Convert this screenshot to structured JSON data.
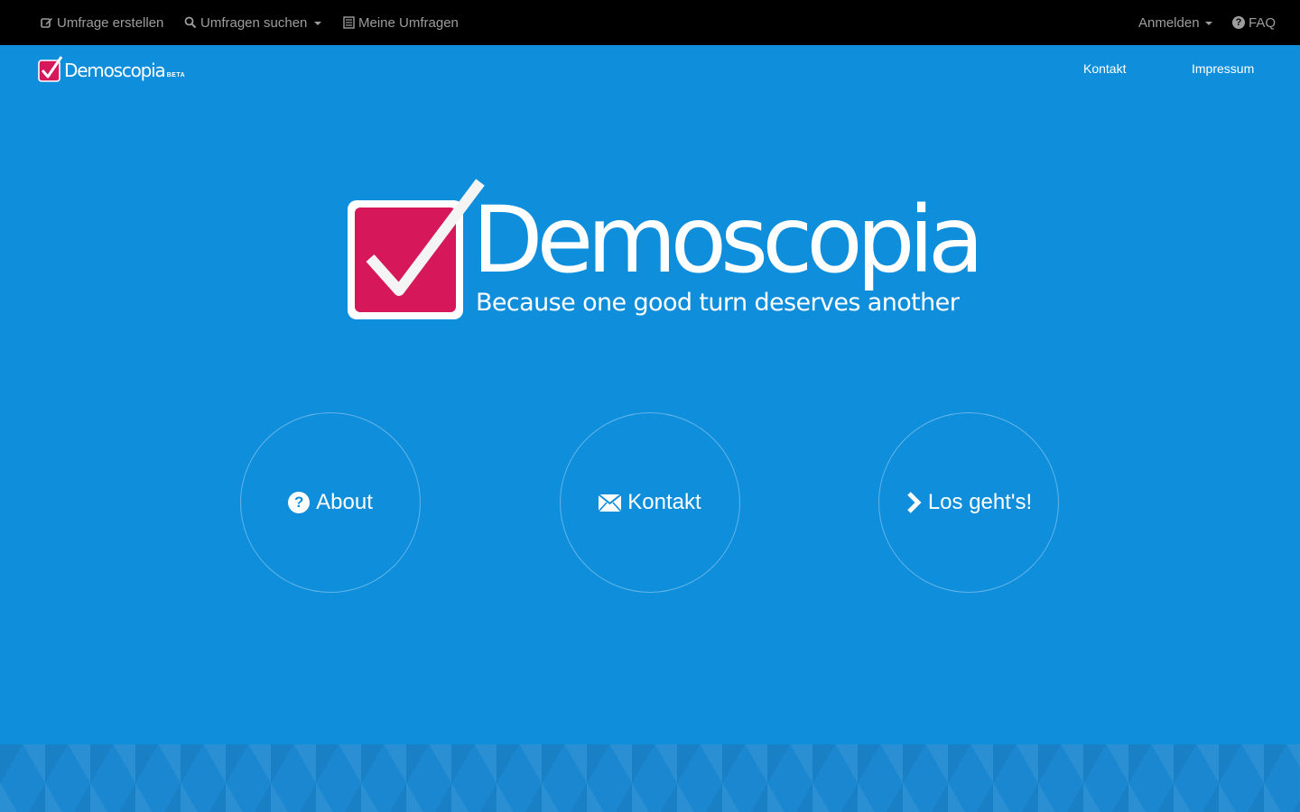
{
  "topnav": {
    "create_survey": "Umfrage erstellen",
    "search_surveys": "Umfragen suchen",
    "my_surveys": "Meine Umfragen",
    "login": "Anmelden",
    "faq": "FAQ"
  },
  "header": {
    "brand": "Demoscopia",
    "beta": "BETA",
    "links": [
      "Kontakt",
      "Impressum"
    ]
  },
  "hero": {
    "title": "Demoscopia",
    "tagline": "Because one good turn deserves another"
  },
  "actions": [
    {
      "label": "About",
      "icon": "question-circle-icon"
    },
    {
      "label": "Kontakt",
      "icon": "envelope-icon"
    },
    {
      "label": "Los geht's!",
      "icon": "chevron-right-icon"
    }
  ],
  "colors": {
    "background": "#0f8edc",
    "topbar": "#000000",
    "topbar_text": "#9d9d9d",
    "logo_box": "#d6185b",
    "white": "#ffffff"
  }
}
